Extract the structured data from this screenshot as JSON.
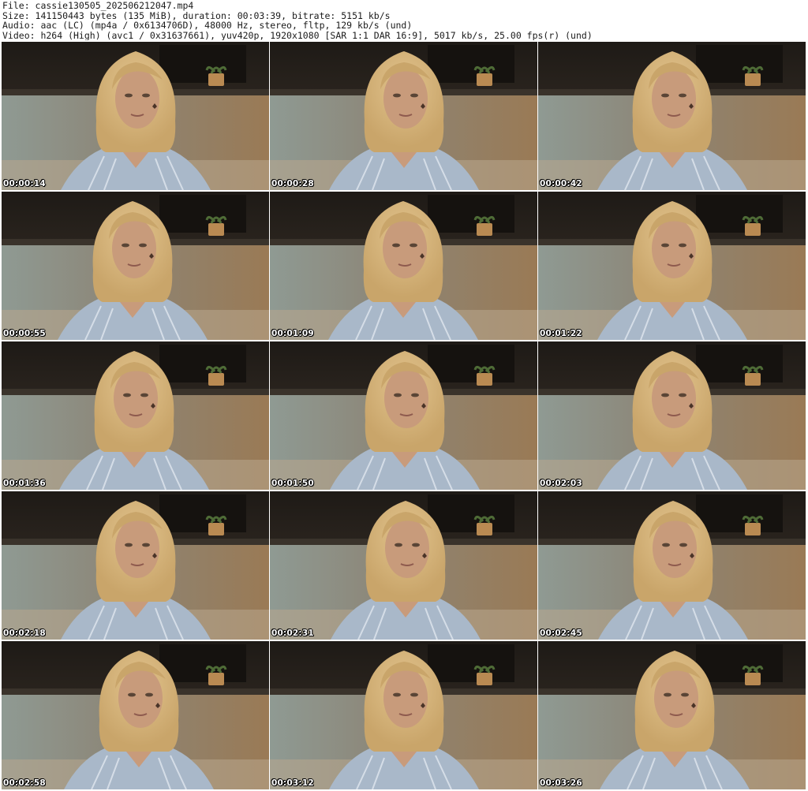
{
  "header": {
    "lines": [
      "File: cassie130505_202506212047.mp4",
      "Size: 141150443 bytes (135 MiB), duration: 00:03:39, bitrate: 5151 kb/s",
      "Audio: aac (LC) (mp4a / 0x6134706D), 48000 Hz, stereo, fltp, 129 kb/s (und)",
      "Video: h264 (High) (avc1 / 0x31637661), yuv420p, 1920x1080 [SAR 1:1 DAR 16:9], 5017 kb/s, 25.00 fps(r) (und)"
    ]
  },
  "thumbnails": [
    {
      "timestamp": "00:00:14",
      "head_shift": 0
    },
    {
      "timestamp": "00:00:28",
      "head_shift": 0
    },
    {
      "timestamp": "00:00:42",
      "head_shift": 0
    },
    {
      "timestamp": "00:00:55",
      "head_shift": -4
    },
    {
      "timestamp": "00:01:09",
      "head_shift": -1
    },
    {
      "timestamp": "00:01:22",
      "head_shift": 0
    },
    {
      "timestamp": "00:01:36",
      "head_shift": -2
    },
    {
      "timestamp": "00:01:50",
      "head_shift": 1
    },
    {
      "timestamp": "00:02:03",
      "head_shift": 0
    },
    {
      "timestamp": "00:02:18",
      "head_shift": 0
    },
    {
      "timestamp": "00:02:31",
      "head_shift": 2
    },
    {
      "timestamp": "00:02:45",
      "head_shift": 1
    },
    {
      "timestamp": "00:02:58",
      "head_shift": 4
    },
    {
      "timestamp": "00:03:12",
      "head_shift": 0
    },
    {
      "timestamp": "00:03:26",
      "head_shift": 3
    }
  ],
  "colors": {
    "background": "#ffffff",
    "header_text": "#1a1a1a",
    "timestamp_text": "#ffffff",
    "wall_dark": "#2a241e",
    "wall_warm": "#9a7a55",
    "wall_cool": "#8f9a93",
    "hair": "#c9a56a",
    "skin": "#c89b7b",
    "shirt": "#a9b8c9"
  }
}
